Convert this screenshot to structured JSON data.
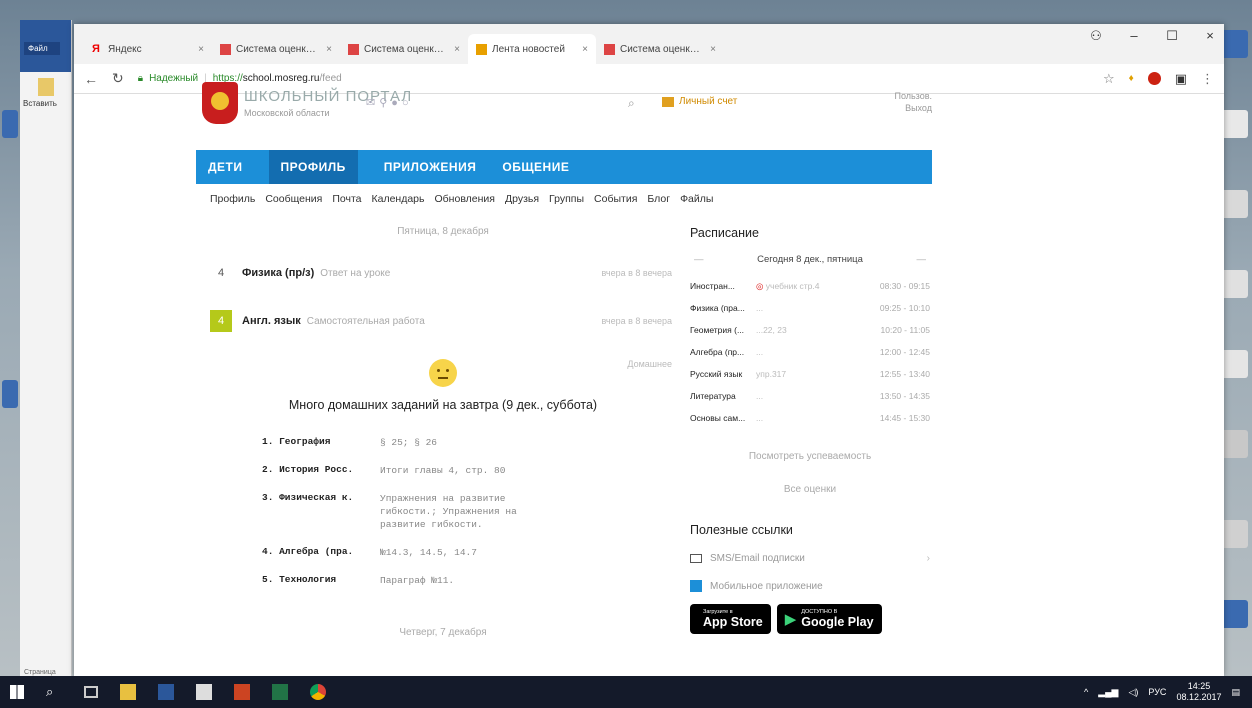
{
  "left_app": {
    "file_label": "Файл",
    "paste_label": "Вставить",
    "status": "Страница"
  },
  "browser": {
    "tabs": [
      {
        "label": "Яндекс",
        "favicon": "yandex-icon",
        "active": false
      },
      {
        "label": "Система оценки качес",
        "favicon": "mosreg-icon",
        "active": false
      },
      {
        "label": "Система оценки качес",
        "favicon": "mosreg-icon",
        "active": false
      },
      {
        "label": "Лента новостей",
        "favicon": "news-icon",
        "active": true
      },
      {
        "label": "Система оценки качес",
        "favicon": "mosreg-icon",
        "active": false
      }
    ],
    "address": {
      "secure_label": "Надежный",
      "protocol": "https://",
      "host": "school.mosreg.ru",
      "path": "/feed"
    }
  },
  "site": {
    "name": "ШКОЛЬНЫЙ ПОРТАЛ",
    "region": "Московской области",
    "cabinet_label": "Личный счет",
    "user_line1": "Пользов.",
    "user_line2": "Выход",
    "main_nav": [
      "ДЕТИ",
      "ПРОФИЛЬ",
      "ПРИЛОЖЕНИЯ",
      "ОБЩЕНИЕ"
    ],
    "main_nav_active": "ПРОФИЛЬ",
    "sub_nav": [
      "Профиль",
      "Сообщения",
      "Почта",
      "Календарь",
      "Обновления",
      "Друзья",
      "Группы",
      "События",
      "Блог",
      "Файлы"
    ]
  },
  "feed": {
    "date_top": "Пятница, 8 декабря",
    "grades": [
      {
        "grade": "4",
        "subject": "Физика (пр/з)",
        "work": "Ответ на уроке",
        "when": "вчера в 8 вечера",
        "green": false
      },
      {
        "grade": "4",
        "subject": "Англ. язык",
        "work": "Самостоятельная работа",
        "when": "вчера в 8 вечера",
        "green": true
      }
    ],
    "hw_date_right": "Домашнее",
    "hw_title": "Много домашних заданий на завтра (9 дек., суббота)",
    "homework": [
      {
        "num": "1. География",
        "task": "§ 25; § 26"
      },
      {
        "num": "2. История Росс.",
        "task": "Итоги главы 4, стр. 80"
      },
      {
        "num": "3. Физическая к.",
        "task": "Упражнения на развитие гибкости.; Упражнения на развитие гибкости."
      },
      {
        "num": "4. Алгебра (пра.",
        "task": "№14.3, 14.5, 14.7"
      },
      {
        "num": "5. Технология",
        "task": "Параграф №11."
      }
    ],
    "date_bottom": "Четверг, 7 декабря"
  },
  "schedule": {
    "title": "Расписание",
    "today": "Сегодня 8 дек., пятница",
    "lessons": [
      {
        "name": "Иностран...",
        "room": "учебник стр.4",
        "time": "08:30 - 09:15",
        "icon": true
      },
      {
        "name": "Физика (пра...",
        "room": "...",
        "time": "09:25 - 10:10",
        "icon": false
      },
      {
        "name": "Геометрия (...",
        "room": "...22, 23",
        "time": "10:20 - 11:05",
        "icon": false
      },
      {
        "name": "Алгебра (пр...",
        "room": "...",
        "time": "12:00 - 12:45",
        "icon": false
      },
      {
        "name": "Русский язык",
        "room": "упр.317",
        "time": "12:55 - 13:40",
        "icon": false
      },
      {
        "name": "Литература",
        "room": "...",
        "time": "13:50 - 14:35",
        "icon": false
      },
      {
        "name": "Основы сам...",
        "room": "...",
        "time": "14:45 - 15:30",
        "icon": false
      }
    ],
    "progress_link": "Посмотреть успеваемость",
    "all_grades_link": "Все оценки"
  },
  "useful": {
    "title": "Полезные ссылки",
    "links": [
      "SMS/Email подписки",
      "Мобильное приложение"
    ],
    "appstore_small": "Загрузите в",
    "appstore_big": "App Store",
    "gplay_small": "ДОСТУПНО В",
    "gplay_big": "Google Play"
  },
  "taskbar": {
    "lang": "РУС",
    "time": "14:25",
    "date": "08.12.2017"
  }
}
